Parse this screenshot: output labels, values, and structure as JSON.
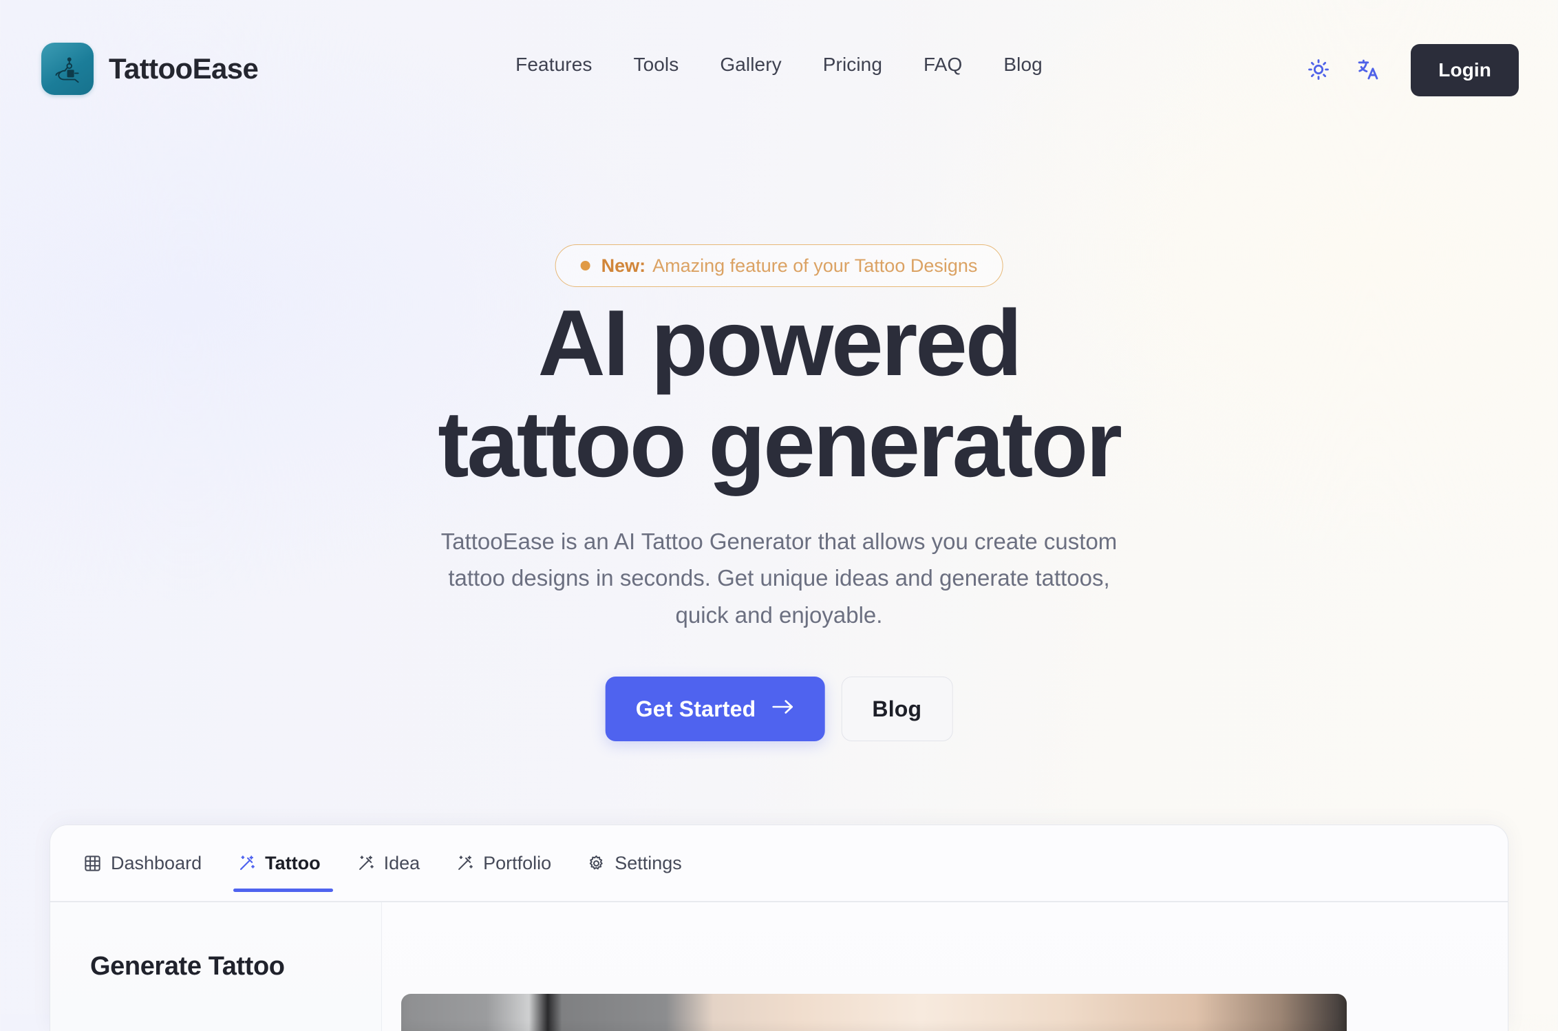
{
  "brand": {
    "name": "TattooEase",
    "logo_icon": "tattoo-machine-icon",
    "logo_color": "#17728d"
  },
  "nav": {
    "items": [
      {
        "label": "Features"
      },
      {
        "label": "Tools"
      },
      {
        "label": "Gallery"
      },
      {
        "label": "Pricing"
      },
      {
        "label": "FAQ"
      },
      {
        "label": "Blog"
      }
    ]
  },
  "header_actions": {
    "theme_icon": "sun-icon",
    "language_icon": "translate-icon",
    "icon_color": "#4f62e8",
    "login_label": "Login",
    "login_bg": "#2b2d3a"
  },
  "hero": {
    "badge": {
      "dot_color": "#e09a45",
      "label": "New:",
      "text": "Amazing feature of your Tattoo Designs",
      "border_color": "#e7b877"
    },
    "headline_line1": "AI powered",
    "headline_line2": "tattoo generator",
    "subtitle": "TattooEase is an AI Tattoo Generator that allows you create custom tattoo designs in seconds. Get unique ideas and generate tattoos, quick and enjoyable.",
    "primary_cta": {
      "label": "Get Started",
      "icon": "arrow-right-icon",
      "color": "#4f63ef"
    },
    "secondary_cta": {
      "label": "Blog"
    }
  },
  "app_preview": {
    "tabs": [
      {
        "label": "Dashboard",
        "icon": "grid-icon",
        "active": false
      },
      {
        "label": "Tattoo",
        "icon": "magic-wand-icon",
        "active": true
      },
      {
        "label": "Idea",
        "icon": "magic-wand-icon",
        "active": false
      },
      {
        "label": "Portfolio",
        "icon": "magic-wand-icon",
        "active": false
      },
      {
        "label": "Settings",
        "icon": "gear-icon",
        "active": false
      }
    ],
    "panel_title": "Generate Tattoo",
    "accent_color": "#4f63ef"
  }
}
